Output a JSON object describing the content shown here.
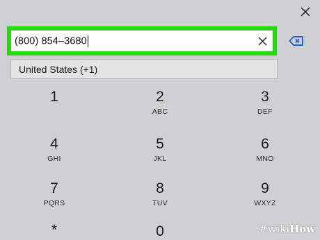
{
  "phone_number": "(800) 854–3680",
  "country": "United States (+1)",
  "keypad": [
    {
      "digit": "1",
      "letters": ""
    },
    {
      "digit": "2",
      "letters": "ABC"
    },
    {
      "digit": "3",
      "letters": "DEF"
    },
    {
      "digit": "4",
      "letters": "GHI"
    },
    {
      "digit": "5",
      "letters": "JKL"
    },
    {
      "digit": "6",
      "letters": "MNO"
    },
    {
      "digit": "7",
      "letters": "PQRS"
    },
    {
      "digit": "8",
      "letters": "TUV"
    },
    {
      "digit": "9",
      "letters": "WXYZ"
    },
    {
      "digit": "*",
      "letters": ""
    },
    {
      "digit": "0",
      "letters": ""
    }
  ],
  "icons": {
    "close": "close-icon",
    "clear": "clear-icon",
    "backspace": "backspace-icon"
  },
  "colors": {
    "highlight": "#2bd414",
    "backspace": "#2a64c8",
    "background": "#cfd0d2"
  },
  "watermark": {
    "hash": "#",
    "part1": "wiki",
    "part2": "How"
  }
}
